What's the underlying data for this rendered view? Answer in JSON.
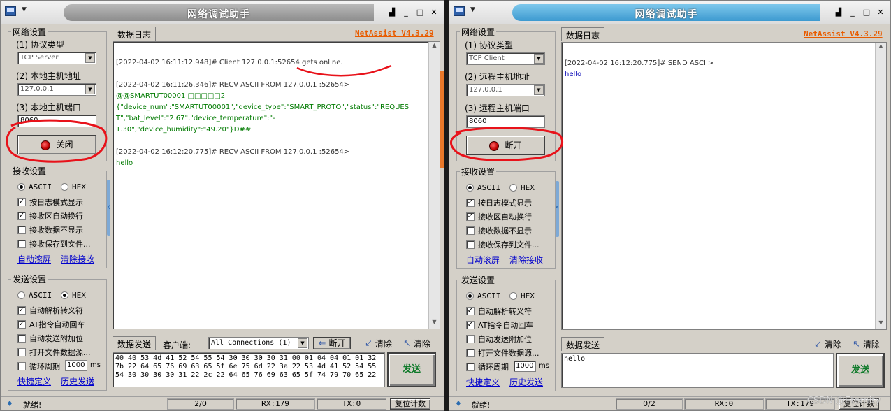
{
  "left": {
    "title": "网络调试助手",
    "window_buttons": [
      "▟",
      "_",
      "□",
      "✕"
    ],
    "version": "NetAssist V4.3.29",
    "net_settings": {
      "title": "网络设置",
      "protocol_label": "(1) 协议类型",
      "protocol_value": "TCP Server",
      "host_label": "(2) 本地主机地址",
      "host_value": "127.0.0.1",
      "port_label": "(3) 本地主机端口",
      "port_value": "8060",
      "connect_button": "关闭"
    },
    "recv_settings": {
      "title": "接收设置",
      "ascii": "ASCII",
      "hex": "HEX",
      "options": [
        "按日志模式显示",
        "接收区自动换行",
        "接收数据不显示",
        "接收保存到文件..."
      ],
      "checked": [
        true,
        true,
        false,
        false
      ],
      "auto_scroll": "自动滚屏",
      "clear_recv": "清除接收"
    },
    "send_settings": {
      "title": "发送设置",
      "ascii": "ASCII",
      "hex": "HEX",
      "options": [
        "自动解析转义符",
        "AT指令自动回车",
        "自动发送附加位",
        "打开文件数据源..."
      ],
      "checked": [
        true,
        true,
        false,
        false
      ],
      "cycle_label": "循环周期",
      "cycle_value": "1000",
      "cycle_unit": "ms",
      "shortcut": "快捷定义",
      "history": "历史发送"
    },
    "log_tab": "数据日志",
    "log": [
      {
        "text": "[2022-04-02 16:11:12.948]# Client 127.0.0.1:52654 gets online.",
        "style": "head"
      },
      {
        "text": "[2022-04-02 16:11:26.346]# RECV ASCII FROM 127.0.0.1 :52654>",
        "style": "head"
      },
      {
        "text": "@@SMARTUT00001 □□□□□2",
        "style": "green"
      },
      {
        "text": "{\"device_num\":\"SMARTUT00001\",\"device_type\":\"SMART_PROTO\",\"status\":\"REQUES",
        "style": "green"
      },
      {
        "text": "T\",\"bat_level\":\"2.67\",\"device_temperature\":\"-",
        "style": "green"
      },
      {
        "text": "1.30\",\"device_humidity\":\"49.20\"}D##",
        "style": "green"
      },
      {
        "text": "[2022-04-02 16:12:20.775]# RECV ASCII FROM 127.0.0.1 :52654>",
        "style": "head"
      },
      {
        "text": "hello",
        "style": "green"
      }
    ],
    "send_bar": {
      "tab": "数据发送",
      "client_label": "客户端:",
      "client_select": "All Connections (1)",
      "disconnect": "断开",
      "clear1": "清除",
      "clear2": "清除"
    },
    "send_content": [
      "40 40 53 4d 41 52 54 55 54 30 30 30 30 31 00 01 04 04 01 01 32",
      "7b 22 64 65 76 69 63 65 5f 6e 75 6d 22 3a 22 53 4d 41 52 54 55",
      "54 30 30 30 30 31 22 2c 22 64 65 76 69 63 65 5f 74 79 70 65 22"
    ],
    "send_button": "发送",
    "status": {
      "ready": "就绪!",
      "count": "2/0",
      "rx": "RX:179",
      "tx": "TX:0",
      "reset": "复位计数"
    }
  },
  "right": {
    "title": "网络调试助手",
    "window_buttons": [
      "▟",
      "_",
      "□",
      "✕"
    ],
    "version": "NetAssist V4.3.29",
    "net_settings": {
      "title": "网络设置",
      "protocol_label": "(1) 协议类型",
      "protocol_value": "TCP Client",
      "host_label": "(2) 远程主机地址",
      "host_value": "127.0.0.1",
      "port_label": "(3) 远程主机端口",
      "port_value": "8060",
      "connect_button": "断开"
    },
    "recv_settings": {
      "title": "接收设置",
      "ascii": "ASCII",
      "hex": "HEX",
      "options": [
        "按日志模式显示",
        "接收区自动换行",
        "接收数据不显示",
        "接收保存到文件..."
      ],
      "checked": [
        true,
        true,
        false,
        false
      ],
      "auto_scroll": "自动滚屏",
      "clear_recv": "清除接收"
    },
    "send_settings": {
      "title": "发送设置",
      "ascii": "ASCII",
      "hex": "HEX",
      "options": [
        "自动解析转义符",
        "AT指令自动回车",
        "自动发送附加位",
        "打开文件数据源..."
      ],
      "checked": [
        true,
        true,
        false,
        false
      ],
      "cycle_label": "循环周期",
      "cycle_value": "1000",
      "cycle_unit": "ms",
      "shortcut": "快捷定义",
      "history": "历史发送"
    },
    "log_tab": "数据日志",
    "log": [
      {
        "text": "[2022-04-02 16:12:20.775]# SEND ASCII>",
        "style": "head"
      },
      {
        "text": "hello",
        "style": "blue"
      }
    ],
    "send_bar": {
      "tab": "数据发送",
      "clear1": "清除",
      "clear2": "清除"
    },
    "send_content": [
      "hello"
    ],
    "send_button": "发送",
    "status": {
      "ready": "就绪!",
      "count": "0/2",
      "rx": "RX:0",
      "tx": "TX:179",
      "reset": "复位计数"
    }
  },
  "watermark": "CSDN @Eternity"
}
